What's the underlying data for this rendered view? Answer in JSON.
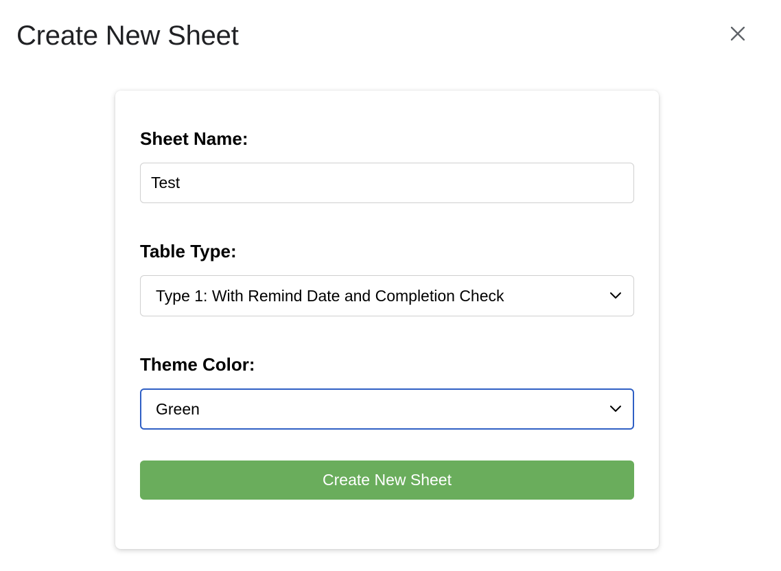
{
  "dialog": {
    "title": "Create New Sheet",
    "close_icon": "close-icon"
  },
  "form": {
    "sheet_name": {
      "label": "Sheet Name:",
      "value": "Test"
    },
    "table_type": {
      "label": "Table Type:",
      "selected": "Type 1: With Remind Date and Completion Check",
      "icon": "chevron-down-icon"
    },
    "theme_color": {
      "label": "Theme Color:",
      "selected": "Green",
      "icon": "chevron-down-icon"
    },
    "submit_label": "Create New Sheet"
  },
  "colors": {
    "submit_button": "#6aad5c",
    "focus_border": "#2f5fc4",
    "title_text": "#202124"
  }
}
